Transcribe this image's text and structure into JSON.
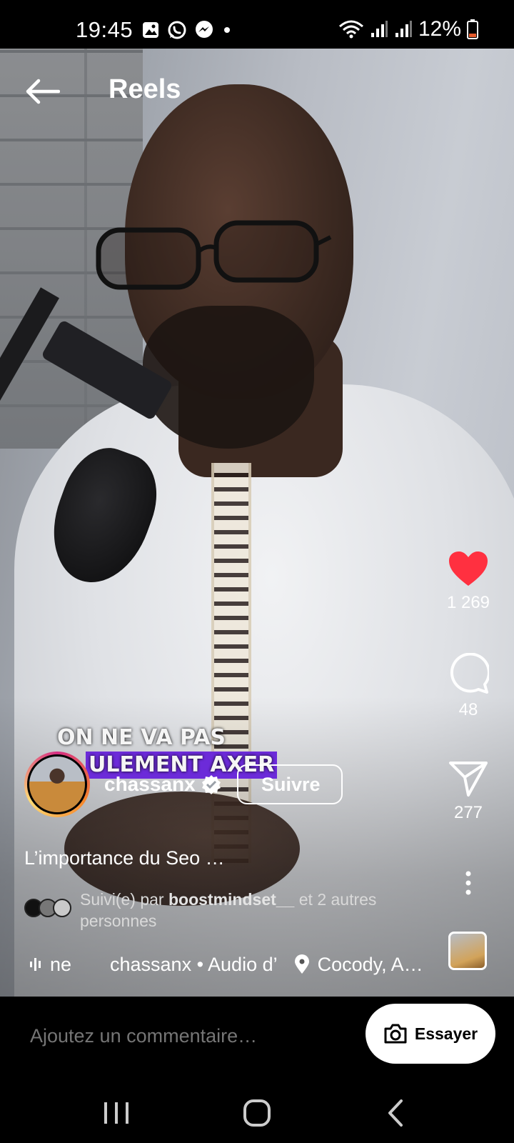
{
  "status_bar": {
    "time": "19:45",
    "battery": "12%",
    "icons_left": [
      "gallery-icon",
      "whatsapp-icon",
      "messenger-icon",
      "dot-icon"
    ],
    "icons_right": [
      "wifi-icon",
      "signal-icon",
      "signal-icon",
      "battery-icon"
    ]
  },
  "header": {
    "title": "Reels"
  },
  "video": {
    "overlay_text_line1": "ON NE VA PAS",
    "overlay_text_line2": "ULEMENT AXER"
  },
  "actions": {
    "likes": "1 269",
    "comments": "48",
    "shares": "277",
    "like_color": "#ff3040"
  },
  "post": {
    "username": "chassanx",
    "follow_label": "Suivre",
    "description": "L’importance du Seo …",
    "followed_by_prefix": "Suivi(e) par ",
    "followed_by_user": "boostmindset__",
    "followed_by_suffix": " et 2 autres personnes",
    "music_text": "ne",
    "music_source": "chassanx • Audio d’",
    "location": "Cocody, A…"
  },
  "comment_bar": {
    "placeholder": "Ajoutez un commentaire…",
    "try_label": "Essayer"
  },
  "nav": [
    "recent-apps",
    "home",
    "back"
  ]
}
